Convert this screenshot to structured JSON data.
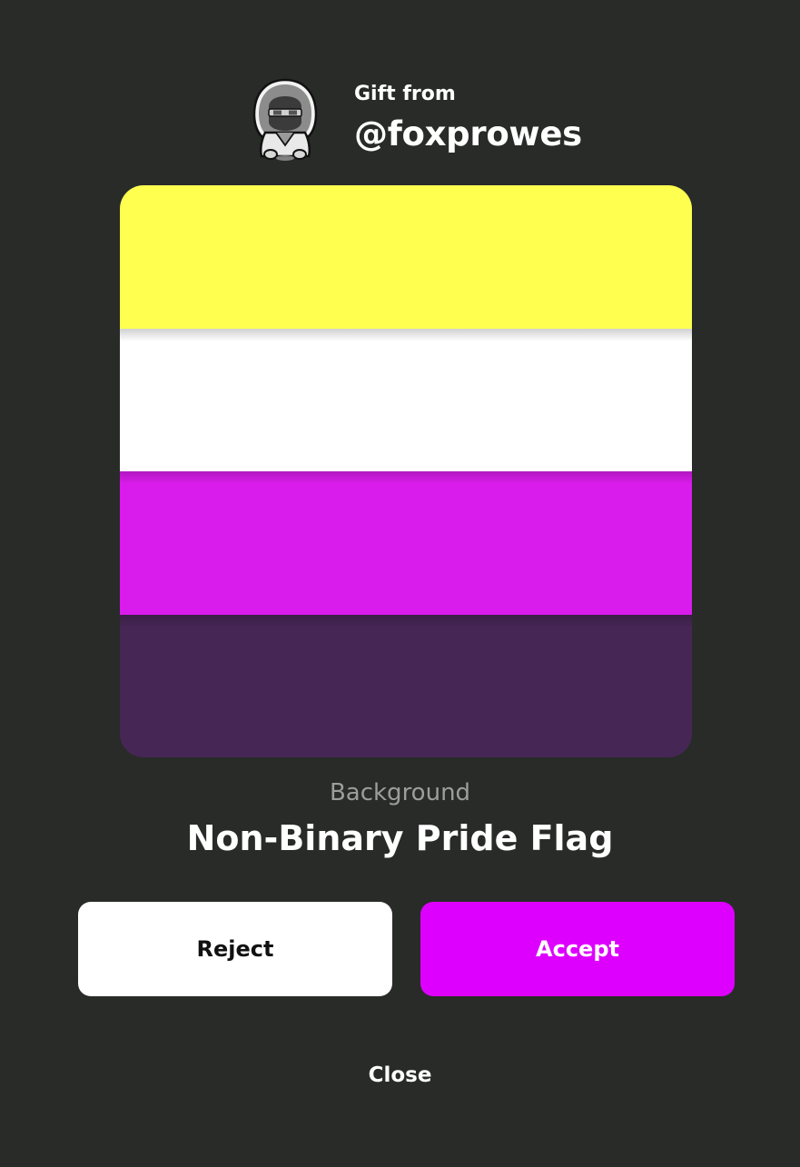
{
  "sender": {
    "label": "Gift from",
    "username": "@foxprowes",
    "avatar_icon": "hooded-character-avatar"
  },
  "item": {
    "category": "Background",
    "name": "Non-Binary Pride Flag",
    "stripes": [
      "#ffff50",
      "#ffffff",
      "#d91ceb",
      "#462655"
    ]
  },
  "actions": {
    "reject_label": "Reject",
    "accept_label": "Accept",
    "close_label": "Close"
  },
  "colors": {
    "background": "#282b28",
    "accent": "#dd00ff",
    "reject_bg": "#ffffff"
  }
}
